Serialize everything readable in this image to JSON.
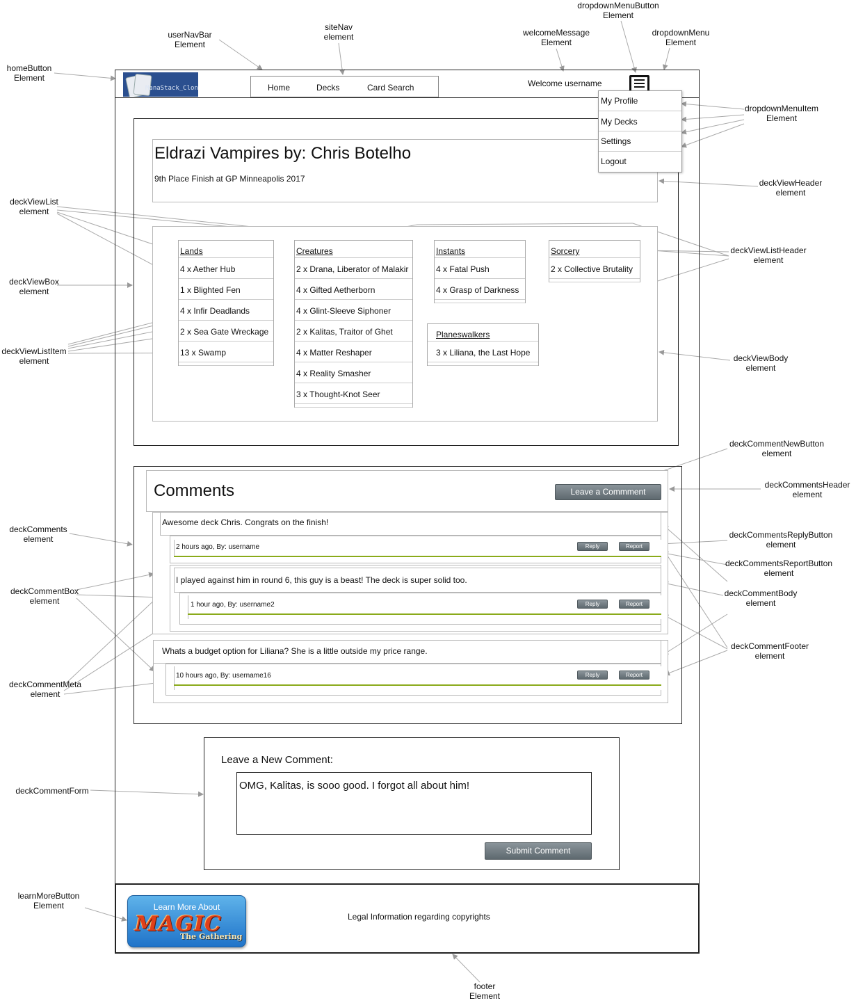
{
  "header": {
    "logo_text": "ManaStack_Clone",
    "nav": [
      "Home",
      "Decks",
      "Card Search"
    ],
    "welcome": "Welcome username",
    "dropdown": [
      "My Profile",
      "My Decks",
      "Settings",
      "Logout"
    ]
  },
  "deck": {
    "title": "Eldrazi Vampires by: Chris Botelho",
    "subtitle": "9th Place Finish at GP Minneapolis 2017",
    "lists": [
      {
        "header": "Lands",
        "items": [
          "4 x Aether Hub",
          "1 x Blighted Fen",
          "4 x Infir Deadlands",
          "2 x Sea Gate Wreckage",
          "13 x Swamp"
        ]
      },
      {
        "header": "Creatures",
        "items": [
          "2 x Drana, Liberator of Malakir",
          "4 x Gifted Aetherborn",
          "4 x Glint-Sleeve Siphoner",
          "2 x Kalitas, Traitor of Ghet",
          "4 x Matter Reshaper",
          "4 x Reality Smasher",
          "3 x Thought-Knot Seer"
        ]
      },
      {
        "header": "Instants",
        "items": [
          "4 x Fatal Push",
          "4 x Grasp of Darkness"
        ]
      },
      {
        "header": "Sorcery",
        "items": [
          "2 x Collective Brutality"
        ]
      },
      {
        "header": "Planeswalkers",
        "items": [
          "3 x Liliana, the Last Hope"
        ]
      }
    ]
  },
  "comments": {
    "title": "Comments",
    "leave_button": "Leave a Commment",
    "reply": "Reply",
    "report": "Report",
    "items": [
      {
        "body": "Awesome deck Chris. Congrats on the finish!",
        "meta": "2 hours ago, By: username"
      },
      {
        "body": "I played against him in round 6, this guy is a beast! The deck is super solid too.",
        "meta": "1 hour ago, By: username2"
      },
      {
        "body": "Whats a budget option for Liliana? She is a little outside my price range.",
        "meta": "10 hours ago, By: username16"
      }
    ]
  },
  "form": {
    "title": "Leave a New Comment:",
    "text": "OMG, Kalitas, is sooo good. I forgot all about him!",
    "submit": "Submit Comment"
  },
  "footer": {
    "learn_more": "Learn More About",
    "magic_word": "MAGIC",
    "magic_sub": "The Gathering",
    "legal": "Legal Information regarding copyrights"
  },
  "annotations": {
    "homeButton": [
      "homeButton",
      "Element"
    ],
    "userNavBar": [
      "userNavBar",
      "Element"
    ],
    "siteNav": [
      "siteNav",
      "element"
    ],
    "welcomeMessage": [
      "welcomeMessage",
      "Element"
    ],
    "dropdownMenuButton": [
      "dropdownMenuButton",
      "Element"
    ],
    "dropdownMenu": [
      "dropdownMenu",
      "Element"
    ],
    "dropdownMenuItem": [
      "dropdownMenuItem",
      "Element"
    ],
    "deckViewHeader": [
      "deckViewHeader",
      "element"
    ],
    "deckViewList": [
      "deckViewList",
      "element"
    ],
    "deckViewListHeader": [
      "deckViewListHeader",
      "element"
    ],
    "deckViewBox": [
      "deckViewBox",
      "element"
    ],
    "deckViewListItem": [
      "deckViewListItem",
      "element"
    ],
    "deckViewBody": [
      "deckViewBody",
      "element"
    ],
    "deckCommentNewButton": [
      "deckCommentNewButton",
      "element"
    ],
    "deckCommentsHeader": [
      "deckCommentsHeader",
      "element"
    ],
    "deckComments": [
      "deckComments",
      "element"
    ],
    "deckCommentsReplyButton": [
      "deckCommentsReplyButton",
      "element"
    ],
    "deckCommentsReportButton": [
      "deckCommentsReportButton",
      "element"
    ],
    "deckCommentBox": [
      "deckCommentBox",
      "element"
    ],
    "deckCommentBody": [
      "deckCommentBody",
      "element"
    ],
    "deckCommentFooter": [
      "deckCommentFooter",
      "element"
    ],
    "deckCommentMeta": [
      "deckCommentMeta",
      "element"
    ],
    "deckCommentForm": [
      "deckCommentForm"
    ],
    "learnMoreButton": [
      "learnMoreButton",
      "Element"
    ],
    "footer": [
      "footer",
      "Element"
    ]
  }
}
